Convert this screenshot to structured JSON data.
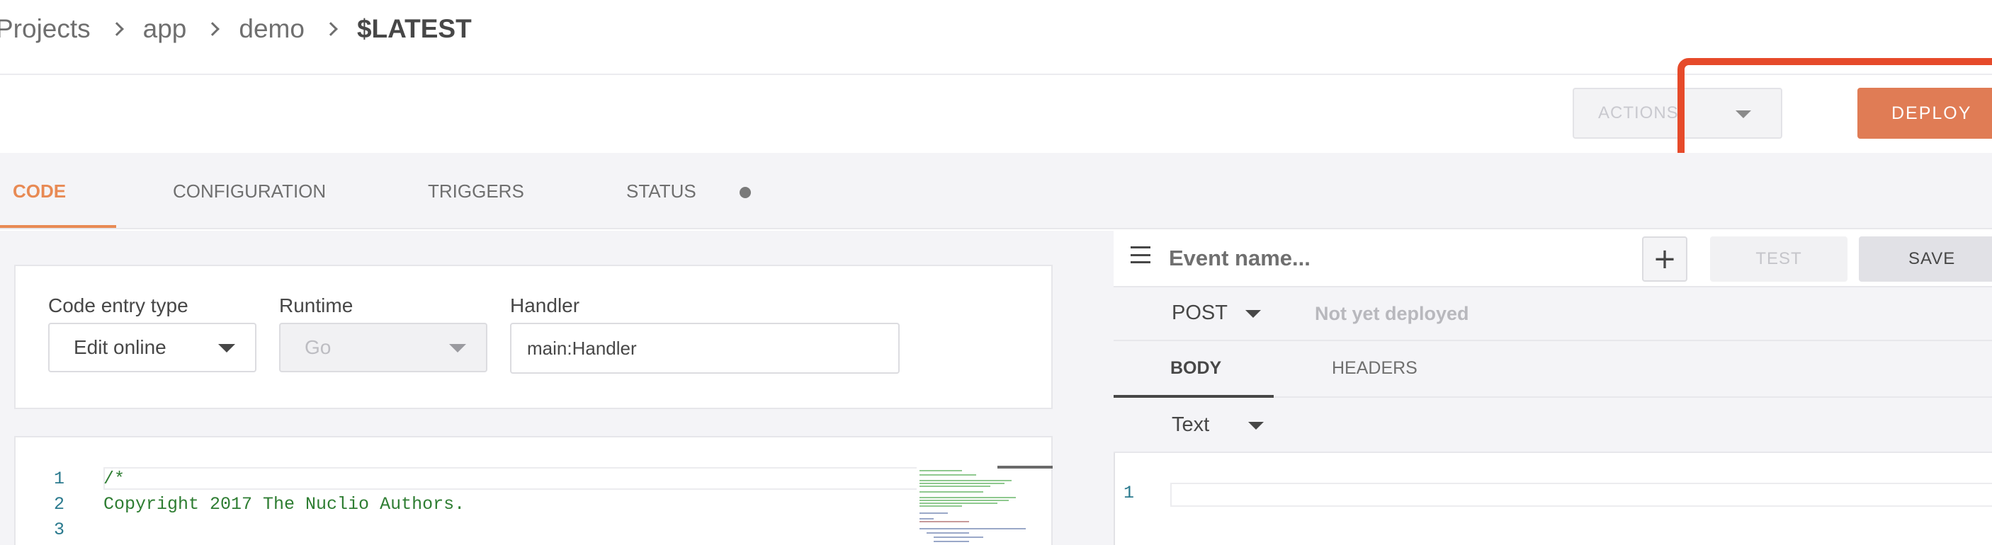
{
  "breadcrumb": {
    "items": [
      "Projects",
      "app",
      "demo"
    ],
    "current": "$LATEST"
  },
  "actionbar": {
    "actions_label": "ACTIONS",
    "deploy_label": "DEPLOY"
  },
  "tabs": [
    {
      "label": "CODE",
      "active": true
    },
    {
      "label": "CONFIGURATION",
      "active": false
    },
    {
      "label": "TRIGGERS",
      "active": false
    },
    {
      "label": "STATUS",
      "active": false
    }
  ],
  "code_form": {
    "entry_type_label": "Code entry type",
    "entry_type_value": "Edit online",
    "runtime_label": "Runtime",
    "runtime_value": "Go",
    "handler_label": "Handler",
    "handler_value": "main:Handler"
  },
  "editor": {
    "line_numbers": [
      "1",
      "2",
      "3"
    ],
    "lines": [
      "/*",
      "Copyright 2017 The Nuclio Authors.",
      ""
    ]
  },
  "test_panel": {
    "event_placeholder": "Event name...",
    "add_label": "+",
    "test_label": "TEST",
    "save_label": "SAVE",
    "method": "POST",
    "deploy_status": "Not yet deployed",
    "tabs": [
      {
        "label": "BODY",
        "active": true
      },
      {
        "label": "HEADERS",
        "active": false
      }
    ],
    "body_type": "Text",
    "body_line_number": "1"
  },
  "colors": {
    "accent": "#e88a54",
    "deploy": "#e07c55",
    "highlight": "#e64a2a"
  }
}
